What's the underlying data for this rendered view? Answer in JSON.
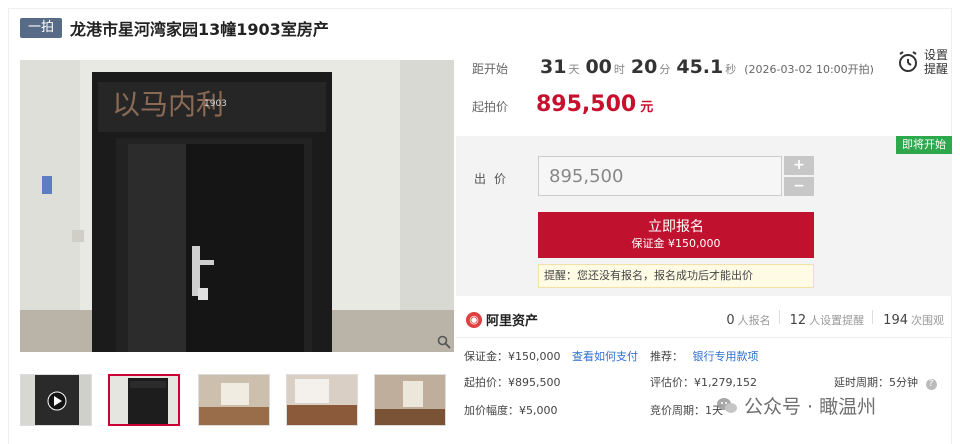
{
  "header": {
    "tag": "一拍",
    "title": "龙港市星河湾家园13幢1903室房产"
  },
  "countdown": {
    "label": "距开始",
    "days": "31",
    "days_unit": "天",
    "hours": "00",
    "hours_unit": "时",
    "minutes": "20",
    "minutes_unit": "分",
    "seconds": "45.1",
    "seconds_unit": "秒",
    "start_time": "(2026-03-02 10:00开拍)"
  },
  "reminder": {
    "label": "设置提醒"
  },
  "starting_price": {
    "label": "起拍价",
    "value": "895,500",
    "unit": "元"
  },
  "bid": {
    "status_badge": "即将开始",
    "label": "出价",
    "value": "895,500",
    "plus": "+",
    "minus": "−",
    "signup_label": "立即报名",
    "deposit_line": "保证金 ¥150,000",
    "notice": "提醒：您还没有报名，报名成功后才能出价"
  },
  "platform": {
    "name": "阿里资产",
    "signups": "0",
    "signups_unit": "人报名",
    "reminders": "12",
    "reminders_unit": "人设置提醒",
    "views": "194",
    "views_unit": "次围观"
  },
  "info": {
    "deposit": "保证金：¥150,000",
    "deposit_link": "查看如何支付",
    "recommend": "推荐：",
    "recommend_link": "银行专用款项",
    "start_price": "起拍价：¥895,500",
    "appraisal": "评估价：¥1,279,152",
    "delay": "延时周期：5分钟",
    "increment": "加价幅度：¥5,000",
    "cycle": "竞价周期：1天"
  },
  "gallery": {
    "door_plate": "以马内利",
    "door_number": "1903",
    "thumbnails": [
      "video-thumb",
      "door-thumb",
      "room-thumb-1",
      "room-thumb-2",
      "room-thumb-3"
    ]
  },
  "watermark": {
    "text": "公众号 · 瞰温州"
  },
  "colors": {
    "accent_red": "#c0122f",
    "badge_green": "#2ea84c",
    "tag_blue": "#586b86",
    "link_blue": "#2c6fd1"
  }
}
